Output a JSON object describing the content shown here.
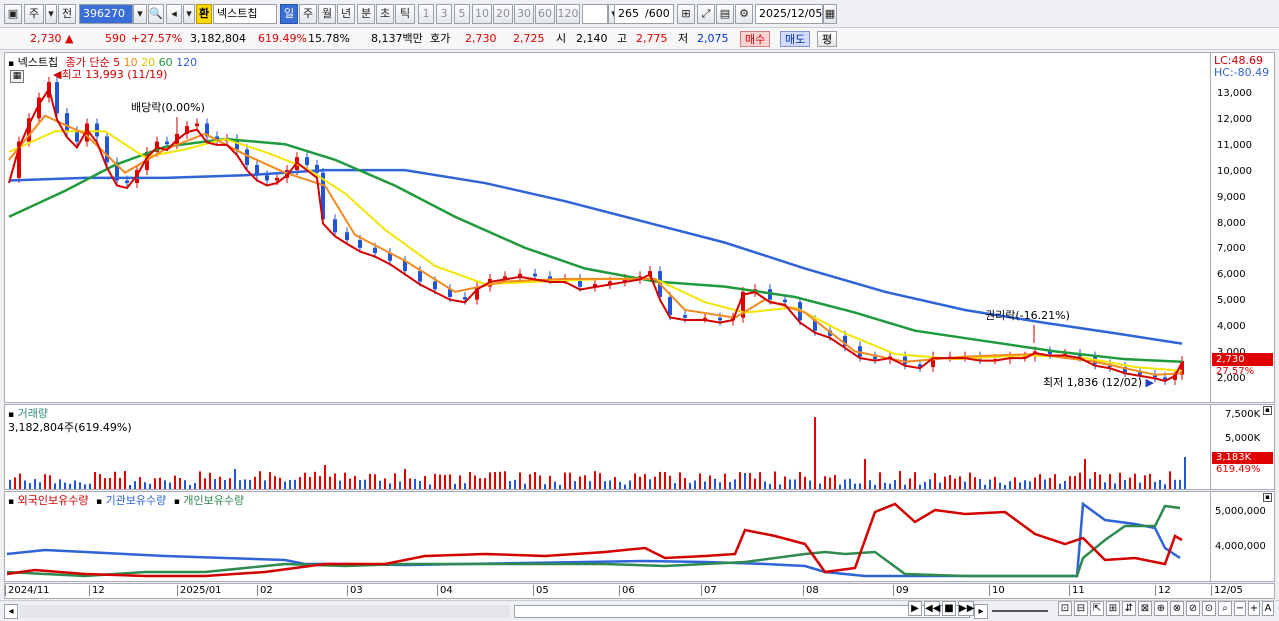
{
  "toolbar": {
    "ju": "주",
    "jeon": "전",
    "code": "396270",
    "hwan": "환",
    "name": "넥스트칩",
    "periods": [
      "일",
      "주",
      "월",
      "년",
      "분",
      "초",
      "틱"
    ],
    "numbers": [
      "1",
      "3",
      "5",
      "10",
      "20",
      "30",
      "60",
      "120"
    ],
    "count": "265",
    "count_total": "/600",
    "date": "2025/12/05"
  },
  "quote": {
    "price": "2,730",
    "change": "590",
    "change_pct": "+27.57%",
    "volume": "3,182,804",
    "volume_pct": "619.49%",
    "turnover": "15.78%",
    "amount": "8,137백만",
    "hoga_label": "호가",
    "bid": "2,730",
    "ask": "2,725",
    "open_label": "시",
    "open": "2,140",
    "high_label": "고",
    "high": "2,775",
    "low_label": "저",
    "low": "2,075",
    "buy": "매수",
    "sell": "매도",
    "pyeong": "평"
  },
  "price_panel": {
    "name": "넥스트칩",
    "legend_prefix": "종가 단순",
    "ma": [
      {
        "label": "5",
        "color": "#e00000"
      },
      {
        "label": "10",
        "color": "#f28a1e"
      },
      {
        "label": "20",
        "color": "#f2e600"
      },
      {
        "label": "60",
        "color": "#1f9a3c"
      },
      {
        "label": "120",
        "color": "#2f63d8"
      }
    ],
    "high_note": "최고 13,993 (11/19)",
    "dividend_note": "배당락(0.00%)",
    "rights_note": "권리락(-16.21%)",
    "low_note": "최저 1,836 (12/02)",
    "lc": "LC:48.69",
    "hc": "HC:-80.49",
    "current_tag": "2,730",
    "current_pct": "27.57%",
    "yticks": [
      "13,000",
      "12,000",
      "11,000",
      "10,000",
      "9,000",
      "8,000",
      "7,000",
      "6,000",
      "5,000",
      "4,000",
      "3,000",
      "2,000"
    ]
  },
  "volume_panel": {
    "title": "거래량",
    "value": "3,182,804주(619.49%)",
    "yticks": [
      "7,500K",
      "5,000K",
      "2,500K"
    ],
    "tag": "3,183K",
    "tag_pct": "619.49%"
  },
  "holding_panel": {
    "legend": [
      {
        "label": "외국인보유수량",
        "color": "#d40000"
      },
      {
        "label": "기관보유수량",
        "color": "#2f63d8"
      },
      {
        "label": "개인보유수량",
        "color": "#2e8a4e"
      }
    ],
    "yticks": [
      "5,000,000",
      "4,000,000"
    ]
  },
  "xaxis": [
    "2024/11",
    "12",
    "2025/01",
    "02",
    "03",
    "04",
    "05",
    "06",
    "07",
    "08",
    "09",
    "10",
    "11",
    "12",
    "12/05"
  ],
  "colors": {
    "up": "#e00000",
    "down": "#1f55d6"
  }
}
